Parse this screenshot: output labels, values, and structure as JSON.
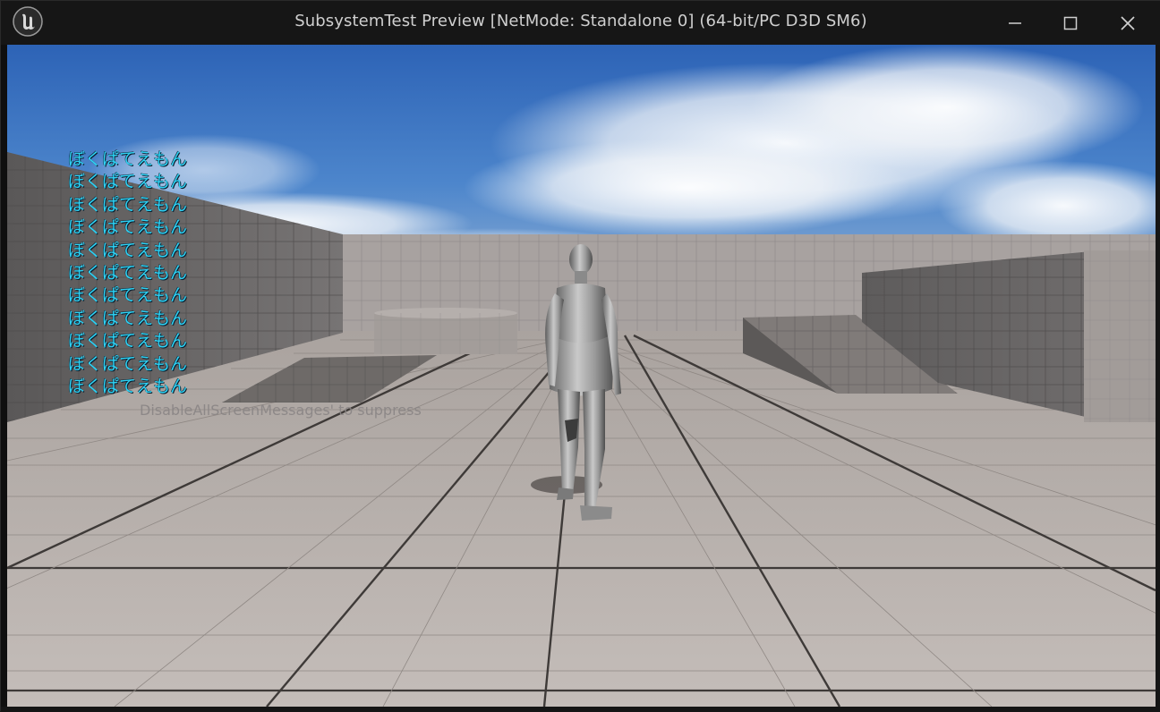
{
  "window": {
    "title": "SubsystemTest Preview [NetMode: Standalone 0]  (64-bit/PC D3D SM6)",
    "logo": "unreal-engine-logo",
    "controls": {
      "minimize": "minimize-icon",
      "maximize": "maximize-icon",
      "close": "close-icon"
    }
  },
  "viewport": {
    "scene": "third-person template level with gray grid floor, walls, ramps and a mannequin character",
    "sky_color": "#3a72c0",
    "floor_color": "#b9b2ae",
    "message_color": "#2fd3f5",
    "debug_messages": [
      "ぼくぱてえもん",
      "ぼくぱてえもん",
      "ぼくぱてえもん",
      "ぼくぱてえもん",
      "ぼくぱてえもん",
      "ぼくぱてえもん",
      "ぼくぱてえもん",
      "ぼくぱてえもん",
      "ぼくぱてえもん",
      "ぼくぱてえもん",
      "ぼくぱてえもん"
    ],
    "suppress_hint": "DisableAllScreenMessages' to suppress"
  }
}
